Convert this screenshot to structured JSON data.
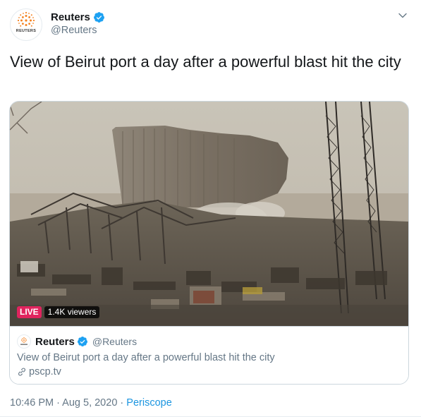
{
  "header": {
    "display_name": "Reuters",
    "handle": "@Reuters",
    "avatar_text": "REUTERS",
    "verified_icon": "verified-badge-icon",
    "more_icon": "chevron-down-icon"
  },
  "tweet": {
    "text": "View of Beirut port a day after a powerful blast hit the city"
  },
  "card": {
    "live_label": "LIVE",
    "viewers": "1.4K viewers",
    "author_name": "Reuters",
    "author_handle": "@Reuters",
    "description": "View of Beirut port a day after a powerful blast hit the city",
    "link_text": "pscp.tv",
    "link_icon": "link-icon",
    "video_scene": "Beirut port blast aftermath"
  },
  "meta": {
    "time": "10:46 PM",
    "separator1": " · ",
    "date": "Aug 5, 2020",
    "separator2": " · ",
    "source": "Periscope"
  },
  "colors": {
    "accent": "#1da1f2",
    "link": "#1b95e0",
    "live": "#e0245e",
    "muted": "#657786",
    "text": "#14171a",
    "border": "#ccd6dd",
    "reuters_orange": "#f58220"
  }
}
